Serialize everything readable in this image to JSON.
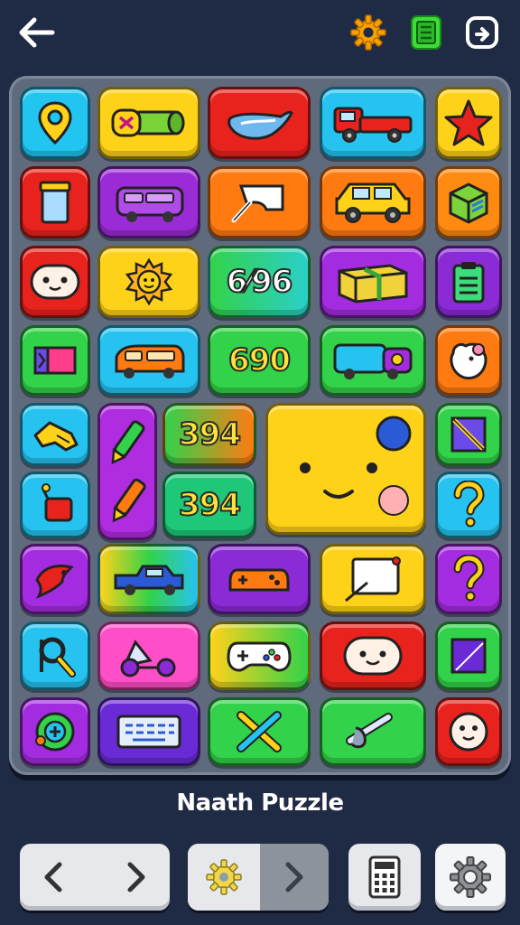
{
  "header": {
    "back_icon": "arrow-left-icon",
    "icons": [
      "gear-icon",
      "notes-icon",
      "exit-icon"
    ]
  },
  "board": {
    "tiles": [
      {
        "row": 1,
        "icon": "location-pin-icon",
        "color": "#22c4f0"
      },
      {
        "row": 1,
        "icon": "hammer-icon",
        "color": "#ffd21a"
      },
      {
        "row": 1,
        "icon": "wing-icon",
        "color": "#e8231e"
      },
      {
        "row": 1,
        "icon": "truck-icon",
        "color": "#27c3f0"
      },
      {
        "row": 1,
        "icon": "star-icon",
        "color": "#ffd21a"
      },
      {
        "row": 2,
        "icon": "jar-icon",
        "color": "#e8231e"
      },
      {
        "row": 2,
        "icon": "van-icon",
        "color": "#9b2bd6"
      },
      {
        "row": 2,
        "icon": "scissor-icon",
        "color": "#ff7b12"
      },
      {
        "row": 2,
        "icon": "car-icon",
        "color": "#ff7b12"
      },
      {
        "row": 2,
        "icon": "box-icon",
        "color": "#ff8a12"
      },
      {
        "row": 3,
        "icon": "face-icon",
        "color": "#e8231e"
      },
      {
        "row": 3,
        "icon": "sun-face-icon",
        "color": "#ffd21a"
      },
      {
        "row": 3,
        "label": "6⁄96",
        "color": "#32d24a"
      },
      {
        "row": 3,
        "icon": "package-icon",
        "color": "#a42ce0"
      },
      {
        "row": 3,
        "icon": "clipboard-icon",
        "color": "#8a2bd6"
      },
      {
        "row": 4,
        "icon": "ribbon-icon",
        "color": "#32d24a"
      },
      {
        "row": 4,
        "icon": "bus-icon",
        "color": "#27c3f0"
      },
      {
        "row": 4,
        "label": "690",
        "color": "#32d24a"
      },
      {
        "row": 4,
        "icon": "truck-side-icon",
        "color": "#32d24a"
      },
      {
        "row": 4,
        "icon": "mouse-icon",
        "color": "#ff7b12"
      },
      {
        "row": 5,
        "icon": "glove-icon",
        "color": "#27c3f0"
      },
      {
        "row": 5,
        "icon": "marker-pen-icon",
        "color": "#b02ce0"
      },
      {
        "row": 5,
        "label": "394",
        "color": "#32d24a"
      },
      {
        "row": 5,
        "icon": "big-face-icon",
        "color": "#ffd21a"
      },
      {
        "row": 5,
        "icon": "ruler-icon",
        "color": "#32d24a"
      },
      {
        "row": 6,
        "icon": "flag-icon",
        "color": "#27c3f0"
      },
      {
        "row": 6,
        "label": "394",
        "color": "#1ec878"
      },
      {
        "row": 6,
        "icon": "question-icon",
        "color": "#27c3f0"
      },
      {
        "row": 7,
        "icon": "red-bird-icon",
        "color": "#a42ce0"
      },
      {
        "row": 7,
        "icon": "blue-car-icon",
        "color": "#ffd21a"
      },
      {
        "row": 7,
        "icon": "controller-icon",
        "color": "#8a2bd6"
      },
      {
        "row": 7,
        "icon": "frame-icon",
        "color": "#ffd21a"
      },
      {
        "row": 7,
        "icon": "question-icon",
        "color": "#a42ce0"
      },
      {
        "row": 8,
        "icon": "magnifier-icon",
        "color": "#27c3f0"
      },
      {
        "row": 8,
        "icon": "scooter-icon",
        "color": "#ff4fc8"
      },
      {
        "row": 8,
        "icon": "gamepad-icon",
        "color": "#ffd21a"
      },
      {
        "row": 8,
        "icon": "smile-icon",
        "color": "#e8231e"
      },
      {
        "row": 8,
        "icon": "panel-icon",
        "color": "#32d24a"
      },
      {
        "row": 9,
        "icon": "badge-icon",
        "color": "#a42ce0"
      },
      {
        "row": 9,
        "icon": "keyboard-icon",
        "color": "#6a2bd6"
      },
      {
        "row": 9,
        "icon": "cross-tools-icon",
        "color": "#32d24a"
      },
      {
        "row": 9,
        "icon": "wrench-icon",
        "color": "#32d24a"
      },
      {
        "row": 9,
        "icon": "round-face-icon",
        "color": "#e8231e"
      }
    ]
  },
  "footer": {
    "title": "Naath Puzzle",
    "buttons": [
      "prev-next-control",
      "settings-next-control",
      "calculator-button",
      "gear-button"
    ]
  }
}
